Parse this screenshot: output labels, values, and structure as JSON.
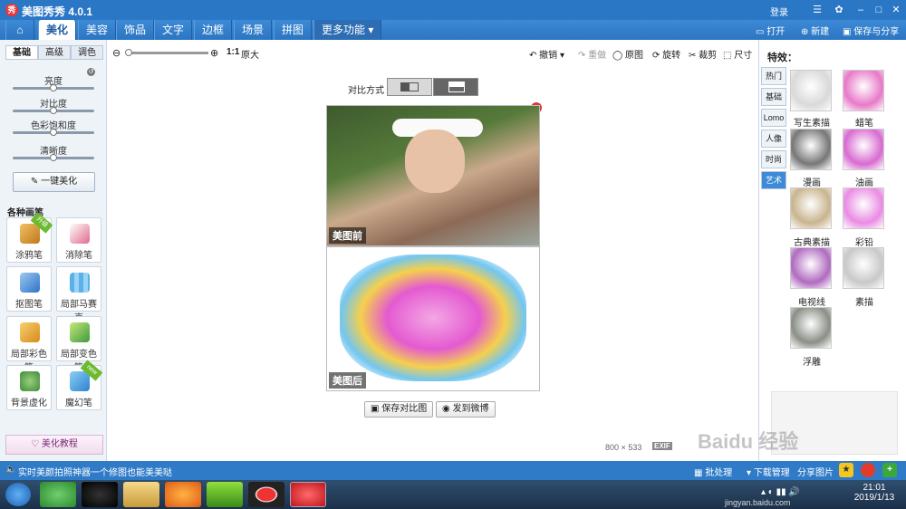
{
  "window": {
    "title": "美图秀秀 4.0.1",
    "login": "登录"
  },
  "tabs": [
    {
      "label": "美化"
    },
    {
      "label": "美容"
    },
    {
      "label": "饰品"
    },
    {
      "label": "文字"
    },
    {
      "label": "边框"
    },
    {
      "label": "场景"
    },
    {
      "label": "拼图"
    },
    {
      "label": "更多功能"
    }
  ],
  "header_actions": {
    "open": "打开",
    "new": "新建",
    "save_share": "保存与分享"
  },
  "left": {
    "subtabs": [
      "基础",
      "高级",
      "调色"
    ],
    "sliders": [
      {
        "label": "亮度",
        "value": 0.5
      },
      {
        "label": "对比度",
        "value": 0.5
      },
      {
        "label": "色彩饱和度",
        "value": 0.5
      },
      {
        "label": "清晰度",
        "value": 0.5
      }
    ],
    "one_key": "一键美化",
    "brushes_title": "各种画笔",
    "tools": [
      {
        "label": "涂鸦笔",
        "badge": "升级"
      },
      {
        "label": "消除笔"
      },
      {
        "label": "抠图笔"
      },
      {
        "label": "局部马赛克"
      },
      {
        "label": "局部彩色笔"
      },
      {
        "label": "局部变色笔"
      },
      {
        "label": "背景虚化"
      },
      {
        "label": "魔幻笔",
        "badge": "new"
      }
    ],
    "tutorial": "美化教程"
  },
  "toolbar": {
    "ratio": "1:1",
    "actual": "原大",
    "undo": "撤销",
    "redo": "重做",
    "original": "原图",
    "rotate": "旋转",
    "crop": "裁剪",
    "size": "尺寸"
  },
  "compare": {
    "label": "对比方式",
    "before": "美图前",
    "after": "美图后",
    "save_btn": "保存对比图",
    "weibo_btn": "发到微博"
  },
  "info": {
    "width": "800",
    "times": "×",
    "height": "533",
    "exif": "EXIF"
  },
  "right": {
    "title": "特效：",
    "categories": [
      "热门",
      "基础",
      "Lomo",
      "人像",
      "时尚",
      "艺术"
    ],
    "effects": [
      {
        "label": "写生素描",
        "color": "#d9d9d9"
      },
      {
        "label": "蜡笔",
        "color": "#e879c9"
      },
      {
        "label": "漫画",
        "color": "#777777"
      },
      {
        "label": "油画",
        "color": "#d86bd0"
      },
      {
        "label": "古典素描",
        "color": "#c9b48e"
      },
      {
        "label": "彩铅",
        "color": "#ea8be3"
      },
      {
        "label": "电视线",
        "color": "#b06bc0"
      },
      {
        "label": "素描",
        "color": "#c8c8c8"
      },
      {
        "label": "浮雕",
        "color": "#8a8f86"
      }
    ]
  },
  "status": {
    "message": "实时美颜拍照神器一个修图也能美美哒",
    "batch": "批处理",
    "download": "下载管理",
    "share": "分享图片"
  },
  "taskbar": {
    "time": "21:01",
    "date": "2019/1/13"
  },
  "watermark": {
    "text": "Baidu 经验",
    "url": "jingyan.baidu.com"
  }
}
